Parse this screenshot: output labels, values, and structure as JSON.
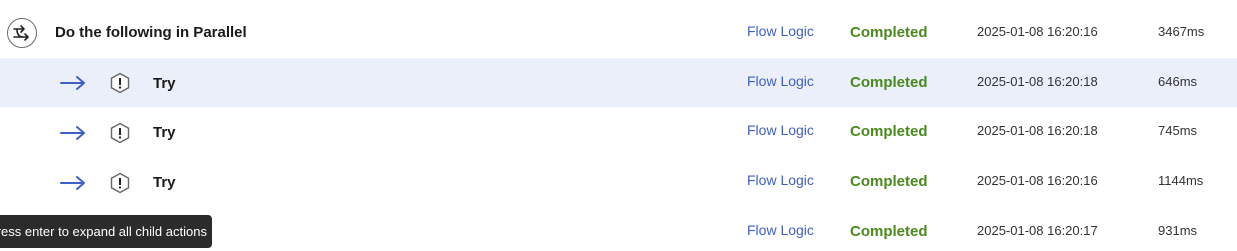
{
  "rows": [
    {
      "name": "Do the following in Parallel",
      "type": "Flow Logic",
      "status": "Completed",
      "timestamp": "2025-01-08 16:20:16",
      "duration": "3467ms"
    },
    {
      "name": "Try",
      "type": "Flow Logic",
      "status": "Completed",
      "timestamp": "2025-01-08 16:20:18",
      "duration": "646ms"
    },
    {
      "name": "Try",
      "type": "Flow Logic",
      "status": "Completed",
      "timestamp": "2025-01-08 16:20:18",
      "duration": "745ms"
    },
    {
      "name": "Try",
      "type": "Flow Logic",
      "status": "Completed",
      "timestamp": "2025-01-08 16:20:16",
      "duration": "1144ms"
    },
    {
      "name": "",
      "type": "Flow Logic",
      "status": "Completed",
      "timestamp": "2025-01-08 16:20:17",
      "duration": "931ms"
    }
  ],
  "tooltip": "Press enter to expand all child actions",
  "icons": {
    "parallel": "parallel-branches-icon",
    "arrow": "right-arrow-icon",
    "try": "hexagon-exclamation-icon"
  },
  "colors": {
    "link": "#3f5fc4",
    "status_completed": "#4a8a1c",
    "row_highlight": "#eaeffa",
    "arrow": "#3f5fc4"
  }
}
